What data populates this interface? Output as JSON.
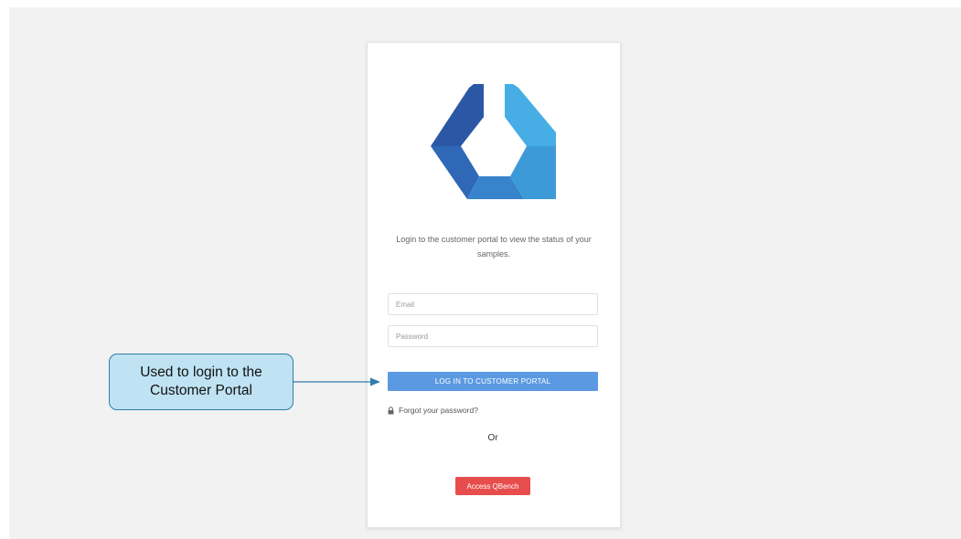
{
  "login_card": {
    "intro_text": "Login to the customer portal to view the status of your samples.",
    "email_placeholder": "Email",
    "password_placeholder": "Password",
    "login_button_label": "LOG IN TO CUSTOMER PORTAL",
    "forgot_password_label": "Forgot your password?",
    "separator_label": "Or",
    "qbench_button_label": "Access QBench"
  },
  "annotation": {
    "callout_line_1": "Used to login to the",
    "callout_line_2": "Customer Portal"
  },
  "icons": {
    "logo": "qbench-logo-icon",
    "lock": "lock-icon",
    "arrow": "arrow-right-icon"
  },
  "colors": {
    "login_button": "#5b9ae3",
    "qbench_button": "#e84d4d",
    "callout_fill": "#bfe3f3",
    "callout_border": "#2e7daa"
  }
}
